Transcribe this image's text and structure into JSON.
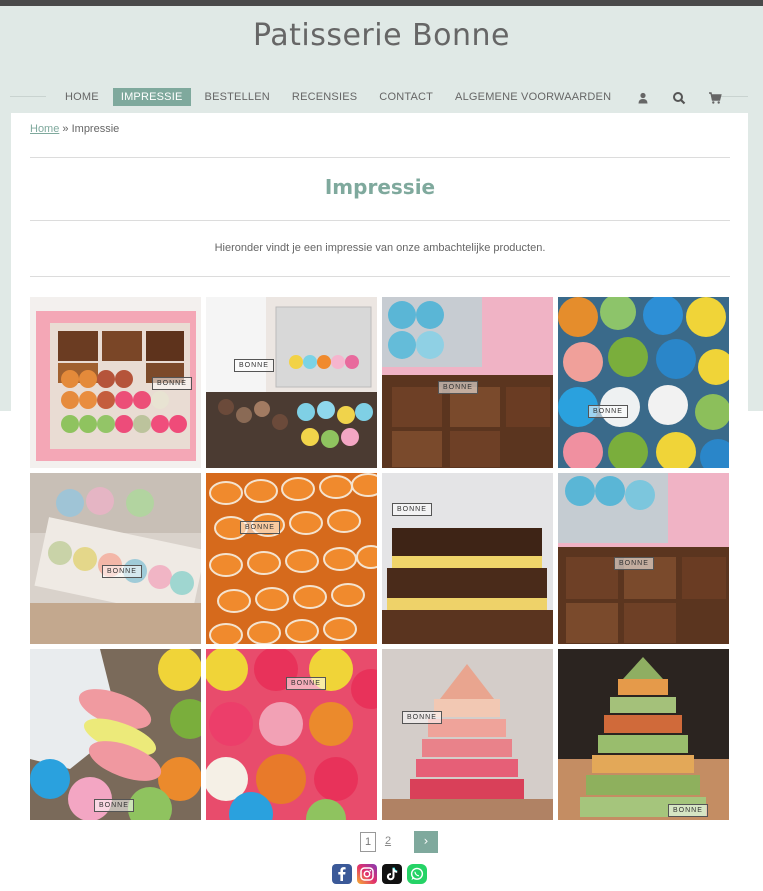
{
  "site": {
    "title": "Patisserie Bonne"
  },
  "nav": {
    "items": [
      {
        "label": "HOME"
      },
      {
        "label": "IMPRESSIE"
      },
      {
        "label": "BESTELLEN"
      },
      {
        "label": "RECENSIES"
      },
      {
        "label": "CONTACT"
      },
      {
        "label": "ALGEMENE VOORWAARDEN"
      }
    ],
    "icons": [
      "user-icon",
      "search-icon",
      "cart-icon"
    ]
  },
  "breadcrumb": {
    "home": "Home",
    "separator": "»",
    "current": "Impressie"
  },
  "page": {
    "title": "Impressie",
    "intro": "Hieronder vindt je een impressie van onze ambachtelijke producten."
  },
  "gallery": {
    "watermark": "BONNE",
    "photos": [
      "Box of brownies and macarons",
      "Gift boxes with macarons and brownies",
      "Macarons and brownies in box",
      "Colorful macarons",
      "Macarons in clear boxes",
      "Orange macarons",
      "Stacked brownie bars",
      "Macarons and brownies in pink box",
      "Hand holding macarons",
      "Red and colorful macarons",
      "Macaron tower",
      "Green and orange macaron tower"
    ]
  },
  "pagination": {
    "pages": [
      "1",
      "2"
    ],
    "current": "1",
    "next": "›"
  },
  "social": [
    "facebook-icon",
    "instagram-icon",
    "tiktok-icon",
    "whatsapp-icon"
  ],
  "colors": {
    "accent": "#7fa99d",
    "header_bg": "#e0e9e6",
    "topbar": "#4a4a4a"
  }
}
